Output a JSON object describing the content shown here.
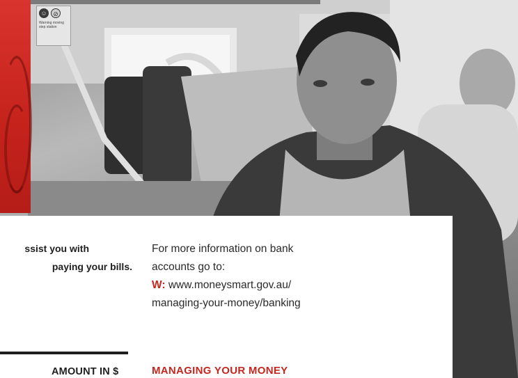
{
  "photo": {
    "sticker_text": "Warning moving step station",
    "sticker_icons": [
      "person-icon",
      "no-smoking-icon"
    ]
  },
  "left_column": {
    "line1": "ssist you with",
    "line2": "paying your bills."
  },
  "table": {
    "amount_header": "AMOUNT IN $"
  },
  "right_column": {
    "line1": "For more information on bank",
    "line2": "accounts go to:",
    "web_label": "W:",
    "web_url_part1": "www.moneysmart.gov.au/",
    "web_url_part2": "managing-your-money/banking"
  },
  "section": {
    "heading": "MANAGING YOUR MONEY"
  },
  "colors": {
    "accent_red": "#c3271f",
    "text_dark": "#1f1f1f"
  }
}
